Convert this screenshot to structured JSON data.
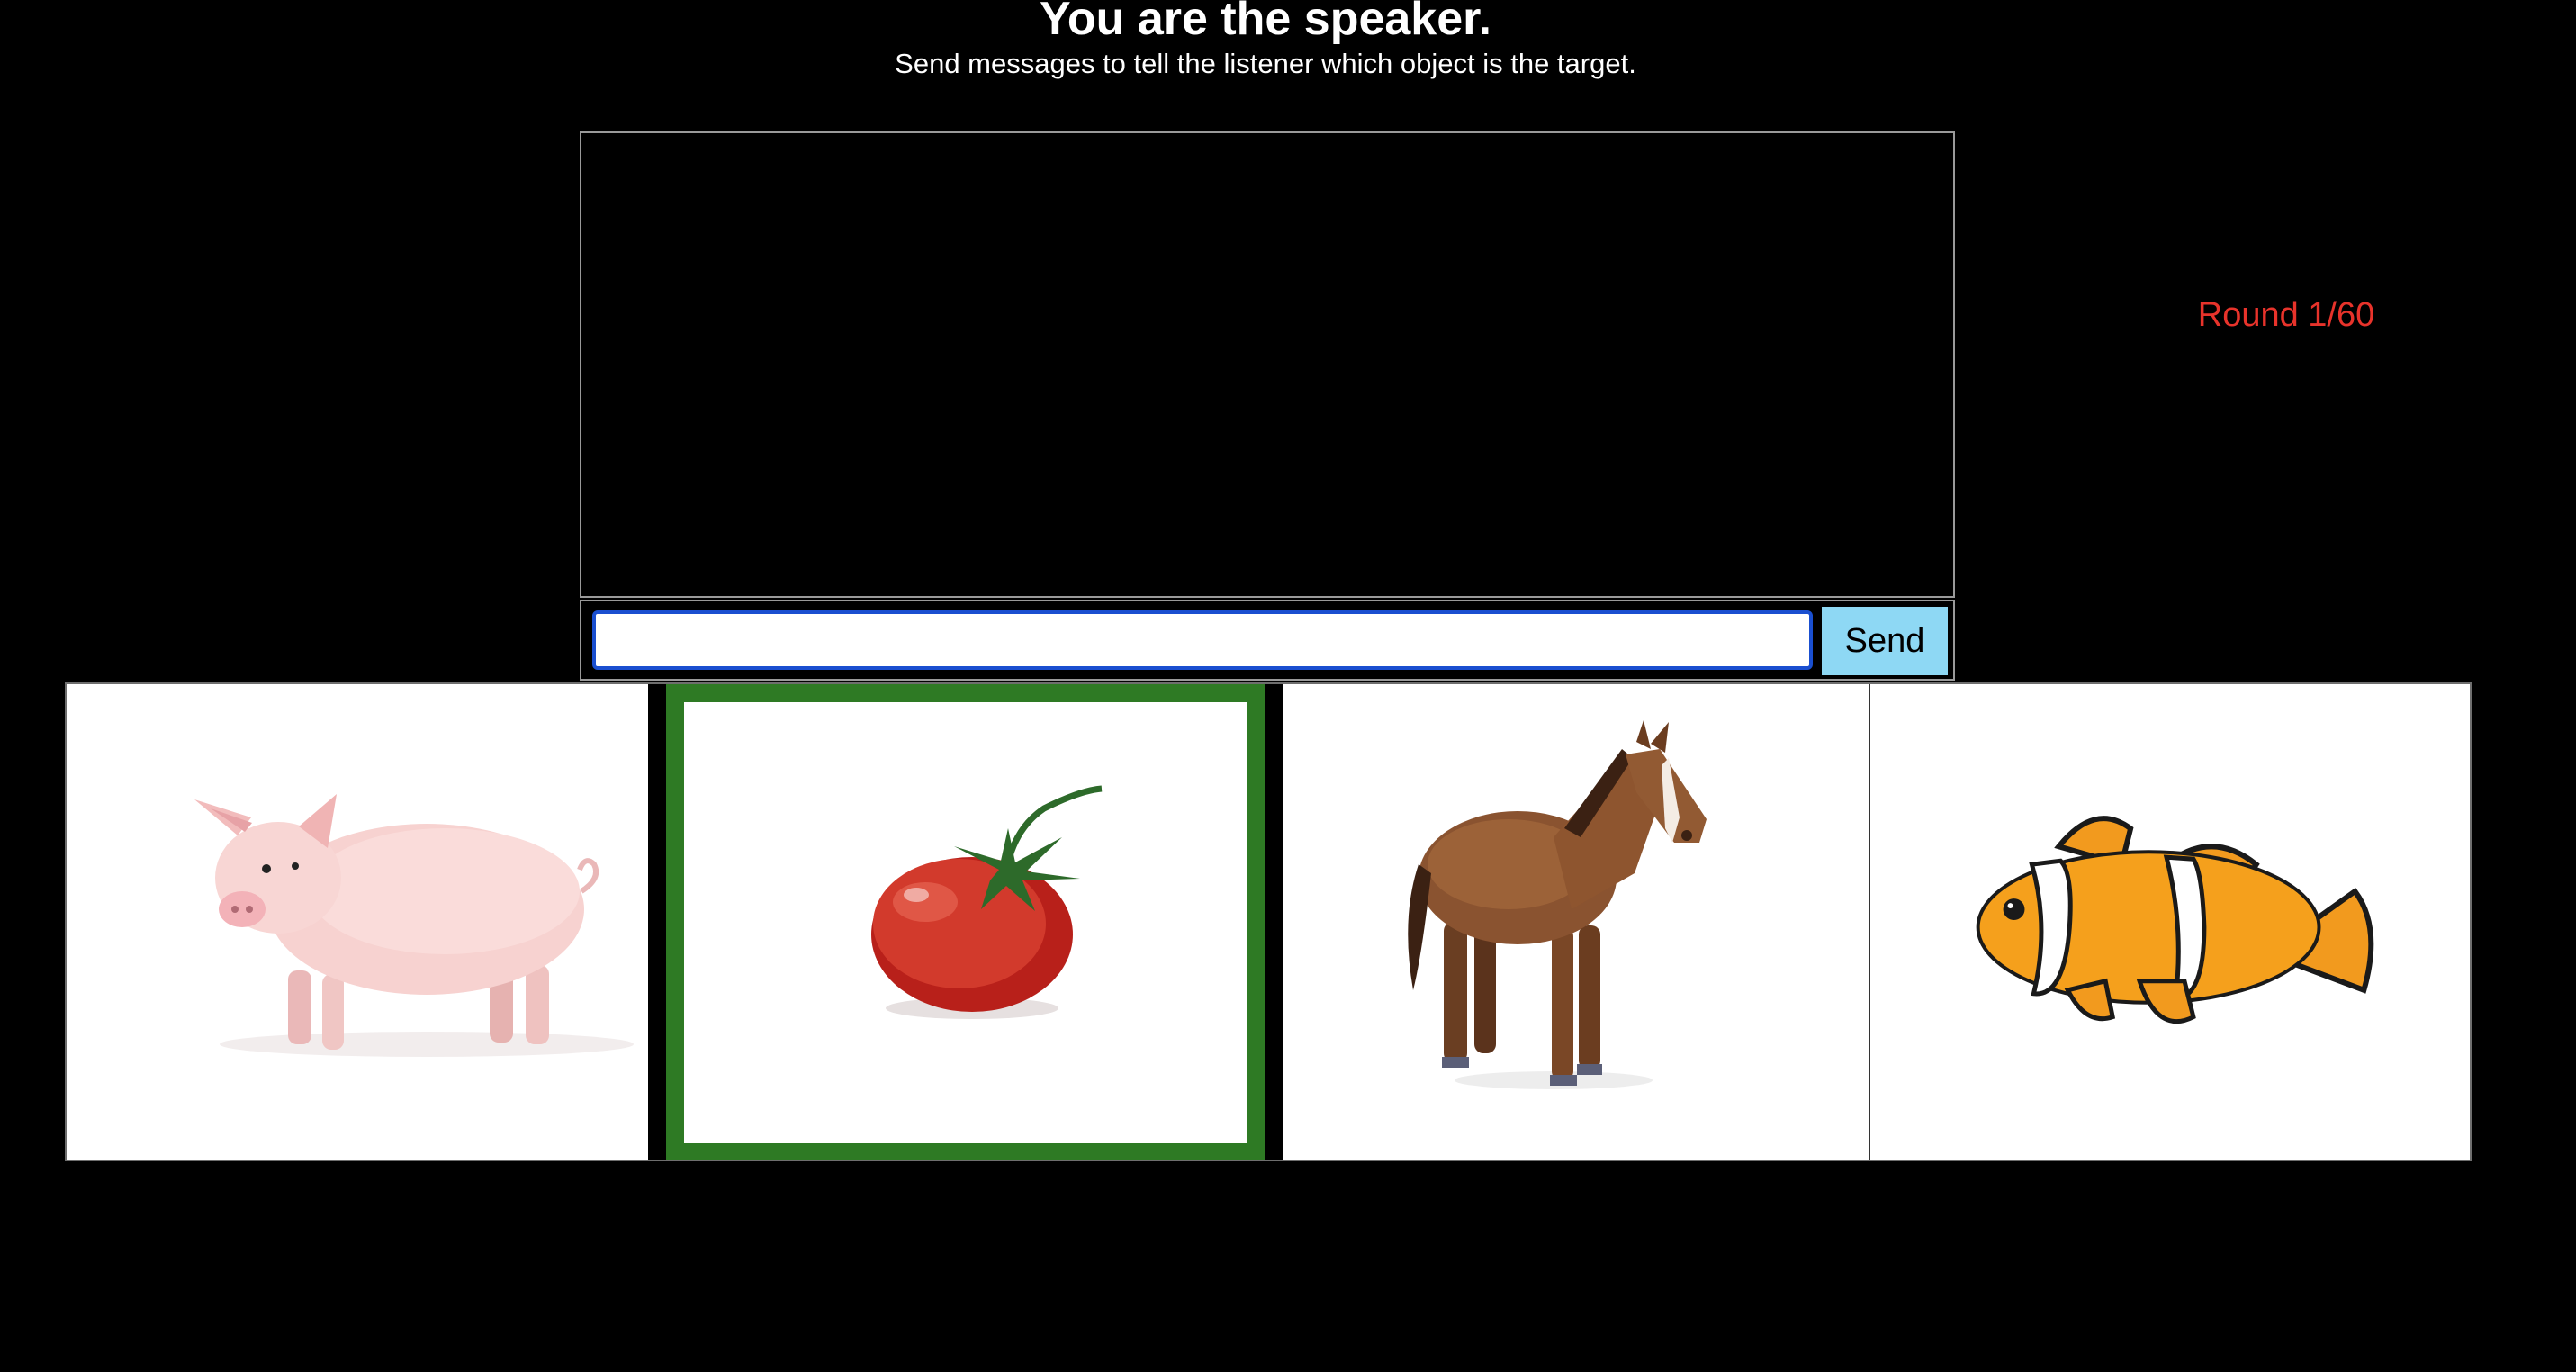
{
  "header": {
    "title": "You are the speaker.",
    "subtitle": "Send messages to tell the listener which object is the target."
  },
  "status": {
    "round_label": "Round 1/60",
    "round_color": "#e8332b"
  },
  "chat": {
    "messages": [],
    "input_value": "",
    "input_placeholder": "",
    "send_label": "Send",
    "send_color": "#8ed8f4"
  },
  "objects": [
    {
      "name": "pig",
      "icon": "pig-image",
      "target": false
    },
    {
      "name": "tomato",
      "icon": "tomato-image",
      "target": true
    },
    {
      "name": "horse",
      "icon": "horse-image",
      "target": false
    },
    {
      "name": "clownfish",
      "icon": "clownfish-image",
      "target": false
    }
  ],
  "colors": {
    "target_border": "#2e7a24",
    "background": "#000000"
  }
}
